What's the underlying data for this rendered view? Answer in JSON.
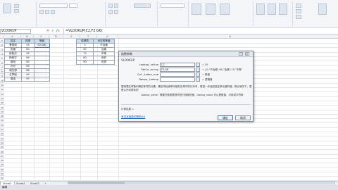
{
  "formula_bar": {
    "name_box": "VLOOKUP",
    "cancel": "✕",
    "enter": "✓",
    "fx": "fx",
    "formula": "=VLOOKUP(C2,F2:G6)"
  },
  "columns": [
    "A",
    "B",
    "C",
    "D",
    "E",
    "F",
    "G",
    "H"
  ],
  "rows": [
    "1",
    "2",
    "3",
    "4",
    "5",
    "6",
    "7",
    "8",
    "9",
    "10",
    "11",
    "12",
    "13",
    "14",
    "15",
    "16",
    "17",
    "18",
    "19",
    "20",
    "21",
    "22",
    "23",
    "24",
    "25",
    "26",
    "27",
    "28",
    "29",
    "30",
    "31",
    "32"
  ],
  "left_table": {
    "headers": [
      "姓名",
      "成绩",
      "等级"
    ],
    "rows": [
      [
        "曹丽丽",
        "55",
        "F2:G6)"
      ],
      [
        "张建",
        "80",
        ""
      ],
      [
        "姚晓月",
        "95",
        ""
      ],
      [
        "杨晓宇",
        "64",
        ""
      ],
      [
        "夏阳",
        "80",
        ""
      ],
      [
        "孙可",
        "60",
        ""
      ],
      [
        "胡文博",
        "88",
        ""
      ],
      [
        "王梦瑶",
        "90",
        ""
      ],
      [
        "周浩",
        "97",
        ""
      ]
    ]
  },
  "right_table": {
    "headers": [
      "成绩表",
      "对应的等级"
    ],
    "rows": [
      [
        "0",
        "不及格"
      ],
      [
        "60",
        "及格"
      ],
      [
        "70",
        "中等"
      ],
      [
        "80",
        "良好"
      ],
      [
        "90",
        "优秀"
      ]
    ]
  },
  "dialog": {
    "title": "函数参数",
    "help_btn": "?",
    "close_btn": "✕",
    "function_name": "VLOOKUP",
    "args": [
      {
        "name": "Lookup_value",
        "value": "C2",
        "result": "= 55"
      },
      {
        "name": "Table_array",
        "value": "F2:G6",
        "result": "= {0,\"不及格\";60,\"及格\";70,\"中等\""
      },
      {
        "name": "Col_index_num",
        "value": "",
        "result": "= 数值"
      },
      {
        "name": "Range_lookup",
        "value": "",
        "result": "= 逻辑值"
      }
    ],
    "description": "搜索表区域首列满足条件的元素，确定待检索单元格在区域中的行序号，再进一步返回选定单元格的值。默认情况下，表是以升序排序的",
    "arg_help_label": "Lookup_value:",
    "arg_help_text": "需要在数据表首列进行搜索的值，lookup_value 可以是数值、引用或字符串",
    "result_label": "计算结果 =",
    "help_link": "有关该函数的帮助(H)",
    "ok": "确定",
    "cancel": "取消"
  },
  "sheet_tabs": [
    "Sheet1",
    "Sheet2",
    "Sheet3"
  ],
  "status_text": "编辑"
}
